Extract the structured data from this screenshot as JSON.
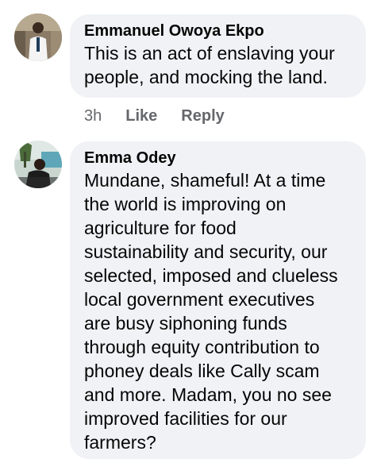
{
  "comments": [
    {
      "author": "Emmanuel Owoya Ekpo",
      "avatar": "profile-photo-emmanuel",
      "text": "This is an act of enslaving your\npeople, and mocking the land.",
      "time": "3h",
      "like_label": "Like",
      "reply_label": "Reply"
    },
    {
      "author": "Emma Odey",
      "avatar": "profile-photo-emma",
      "text": "Mundane, shameful! At a time\nthe world is improving on\nagriculture for food\nsustainability and security, our\nselected, imposed and clueless\nlocal government executives\nare busy siphoning funds\nthrough equity contribution to\nphoney deals like Cally scam\nand more. Madam, you no see\nimproved facilities for our\nfarmers?"
    }
  ],
  "colors": {
    "bubble": "#f0f2f5",
    "text": "#050505",
    "secondary": "#65676b"
  }
}
